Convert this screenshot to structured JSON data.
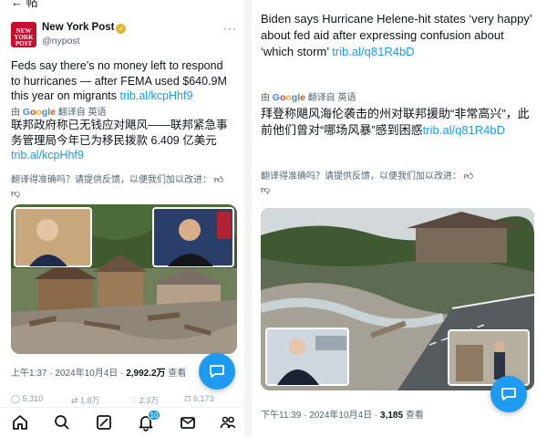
{
  "left": {
    "top_cut_text": "← 帖",
    "author": {
      "avatar_text": "NEW YORK POST",
      "name": "New York Post",
      "handle": "@nypost",
      "more": "···"
    },
    "tweet": {
      "text_before_link": "Feds say there’s no money left to respond to hurricanes — after FEMA used $640.9M this year on migrants ",
      "link": "trib.al/kcpHhf9"
    },
    "translate": {
      "prefix": "由",
      "google": "Google",
      "suffix": "翻译自 英语"
    },
    "translated": {
      "text_before_link": "联邦政府称已无钱应对飓风——联邦紧急事务管理局今年已为移民拨款 6.409 亿美元",
      "link": "trib.al/kcpHhf9"
    },
    "feedback": "翻译得准确吗？请提供反馈，以便我们加以改进：",
    "meta": {
      "time": "上午1:37",
      "date": "2024年10月4日",
      "views": "2,992.2万",
      "views_label": "查看"
    },
    "engagement": [
      "5,310",
      "1.8万",
      "2.3万",
      "6,173"
    ],
    "nav": {
      "badge": "10"
    }
  },
  "right": {
    "tweet": {
      "text_before_link": "Biden says Hurricane Helene-hit states ‘very happy’ about fed aid after expressing confusion about ‘which storm’ ",
      "link": "trib.al/q81R4bD"
    },
    "translate": {
      "prefix": "由",
      "google": "Google",
      "suffix": "翻译自 英语"
    },
    "translated": {
      "text_before_link": "拜登称飓风海伦袭击的州对联邦援助“非常高兴”，此前他们曾对“哪场风暴”感到困惑",
      "link": "trib.al/q81R4bD"
    },
    "feedback": "翻译得准确吗？请提供反馈，以便我们加以改进：",
    "meta": {
      "time": "下午11:39",
      "date": "2024年10月4日",
      "views": "3,185",
      "views_label": "查看"
    }
  },
  "colors": {
    "link": "#1d9bf0",
    "secondary_text": "#536471",
    "avatar_bg": "#c8102e",
    "verified": "#e3b43c"
  }
}
